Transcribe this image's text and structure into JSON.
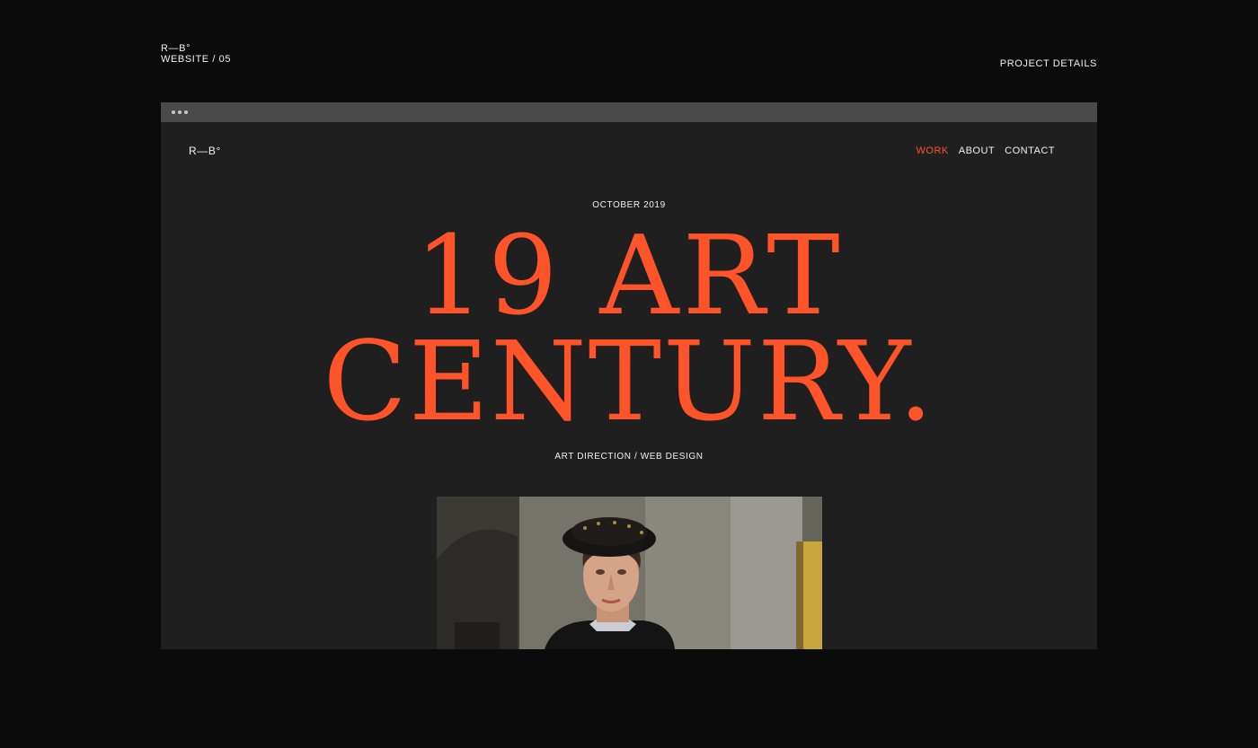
{
  "outer": {
    "brand_logo": "R—B°",
    "brand_sub": "WEBSITE / 05",
    "project_details": "PROJECT DETAILS"
  },
  "site": {
    "logo": "R—B°",
    "nav": [
      {
        "label": "WORK",
        "active": true
      },
      {
        "label": "ABOUT",
        "active": false
      },
      {
        "label": "CONTACT",
        "active": false
      }
    ],
    "date": "OCTOBER 2019",
    "headline_line1": "19 ART",
    "headline_line2": "CENTURY.",
    "tagline": "ART DIRECTION / WEB DESIGN"
  },
  "colors": {
    "background": "#0b0b0b",
    "viewport": "#1f1f1f",
    "browser_bar": "#4a4a4a",
    "accent": "#ff5329",
    "text": "#f2f2f2"
  },
  "image": {
    "subject": "renaissance-portrait-painting"
  }
}
